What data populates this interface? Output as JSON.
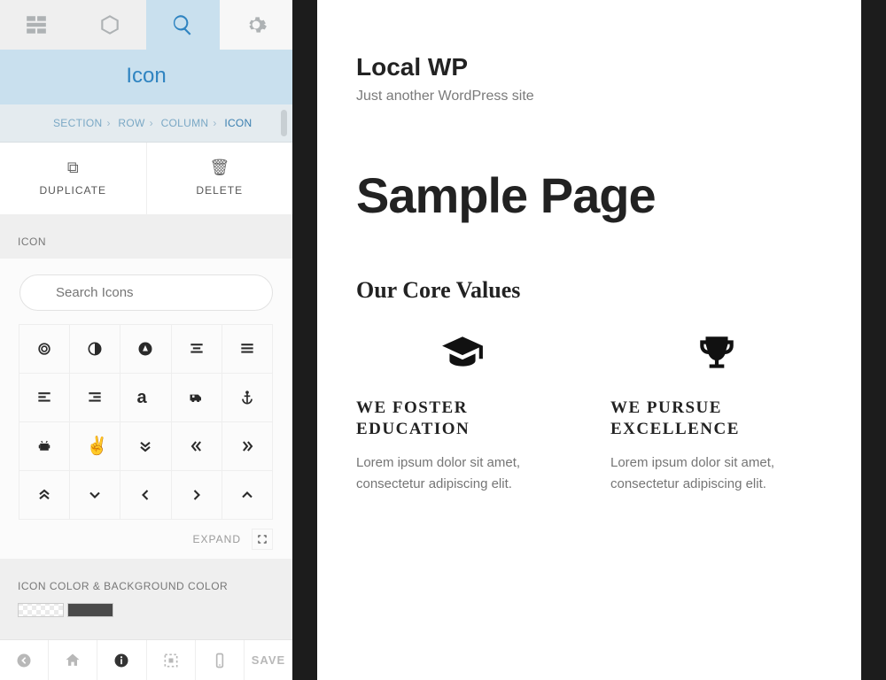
{
  "tabs": {
    "active_index": 2
  },
  "title": "Icon",
  "breadcrumbs": {
    "items": [
      "SECTION",
      "ROW",
      "COLUMN",
      "ICON"
    ]
  },
  "actions": {
    "duplicate": "DUPLICATE",
    "delete": "DELETE"
  },
  "section": {
    "icon_label": "ICON",
    "search_placeholder": "Search Icons",
    "expand_label": "EXPAND",
    "color_label": "ICON COLOR & BACKGROUND COLOR"
  },
  "bottom": {
    "save": "SAVE"
  },
  "preview": {
    "site_title": "Local WP",
    "site_tagline": "Just another WordPress site",
    "page_title": "Sample Page",
    "core_heading": "Our Core Values",
    "values": [
      {
        "title": "WE FOSTER EDUCATION",
        "text": "Lorem ipsum dolor sit amet, consectetur adipiscing elit."
      },
      {
        "title": "WE PURSUE EXCELLENCE",
        "text": "Lorem ipsum dolor sit amet, consectetur adipiscing elit."
      }
    ]
  },
  "icon_glyphs": [
    "icon-500px",
    "icon-adjust",
    "icon-adn",
    "icon-align-center",
    "icon-align-justify",
    "icon-align-left",
    "icon-align-right",
    "icon-amazon",
    "icon-ambulance",
    "icon-anchor",
    "icon-android",
    "icon-angellist",
    "icon-angle-double-down",
    "icon-angle-double-left",
    "icon-angle-double-right",
    "icon-angle-double-up",
    "icon-angle-down",
    "icon-angle-left",
    "icon-angle-right",
    "icon-angle-up"
  ]
}
